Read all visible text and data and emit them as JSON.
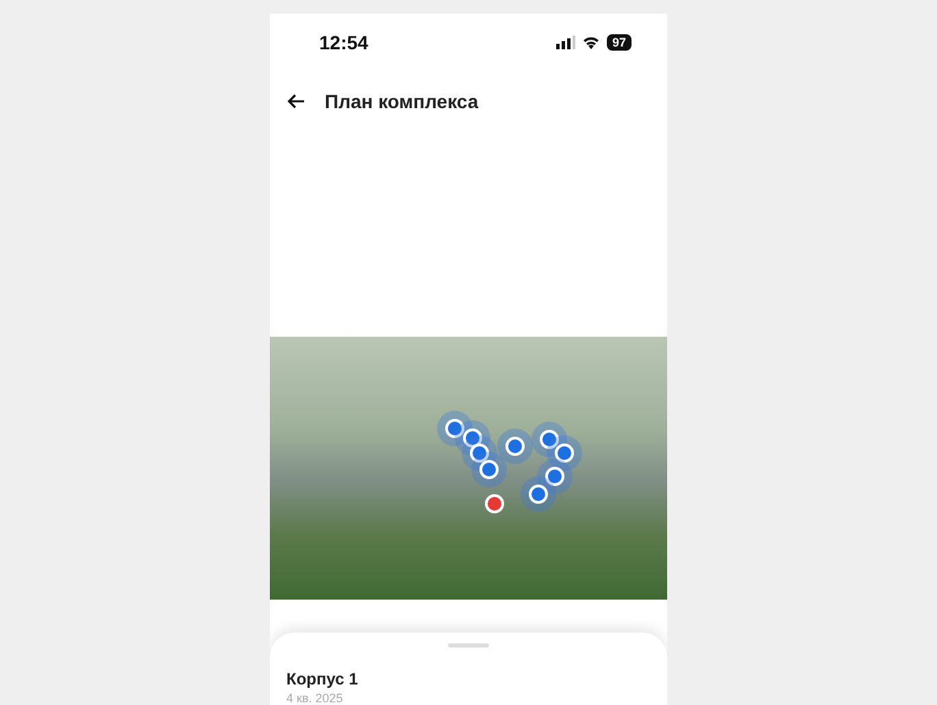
{
  "status_bar": {
    "time": "12:54",
    "battery": "97"
  },
  "header": {
    "title": "План комплекса"
  },
  "plan": {
    "markers": [
      {
        "selected": false
      },
      {
        "selected": false
      },
      {
        "selected": false
      },
      {
        "selected": false
      },
      {
        "selected": false
      },
      {
        "selected": false
      },
      {
        "selected": false
      },
      {
        "selected": false
      },
      {
        "selected": false
      },
      {
        "selected": true
      }
    ]
  },
  "sheet": {
    "title": "Корпус 1",
    "subtitle": "4 кв. 2025"
  }
}
